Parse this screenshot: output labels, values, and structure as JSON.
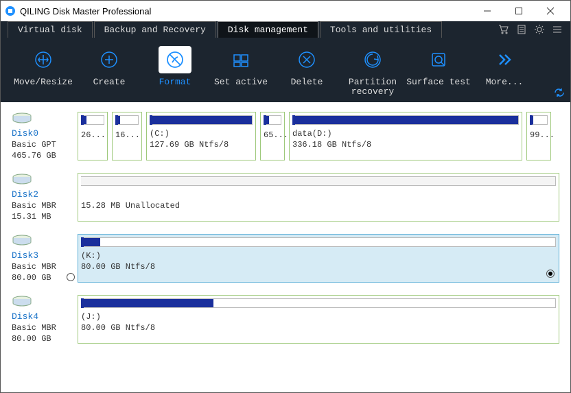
{
  "window": {
    "title": "QILING Disk Master Professional"
  },
  "tabs": {
    "virtual_disk": "Virtual disk",
    "backup": "Backup and Recovery",
    "disk_mgmt": "Disk management",
    "tools": "Tools and utilities"
  },
  "toolbar": {
    "move_resize": "Move/Resize",
    "create": "Create",
    "format": "Format",
    "set_active": "Set active",
    "delete": "Delete",
    "partition_recovery_l1": "Partition",
    "partition_recovery_l2": "recovery",
    "surface_test": "Surface test",
    "more": "More..."
  },
  "disks": {
    "d0": {
      "name": "Disk0",
      "type": "Basic GPT",
      "size": "465.76 GB",
      "p0": {
        "label": "26..."
      },
      "p1": {
        "label": "16..."
      },
      "p2": {
        "name": "(C:)",
        "info": "127.69 GB Ntfs/8"
      },
      "p3": {
        "label": "65..."
      },
      "p4": {
        "name": "data(D:)",
        "info": "336.18 GB Ntfs/8"
      },
      "p5": {
        "label": "99..."
      }
    },
    "d2": {
      "name": "Disk2",
      "type": "Basic MBR",
      "size": "15.31 MB",
      "p0": {
        "info": "15.28 MB Unallocated"
      }
    },
    "d3": {
      "name": "Disk3",
      "type": "Basic MBR",
      "size": "80.00 GB",
      "p0": {
        "name": "(K:)",
        "info": "80.00 GB Ntfs/8"
      }
    },
    "d4": {
      "name": "Disk4",
      "type": "Basic MBR",
      "size": "80.00 GB",
      "p0": {
        "name": "(J:)",
        "info": "80.00 GB Ntfs/8"
      }
    }
  }
}
